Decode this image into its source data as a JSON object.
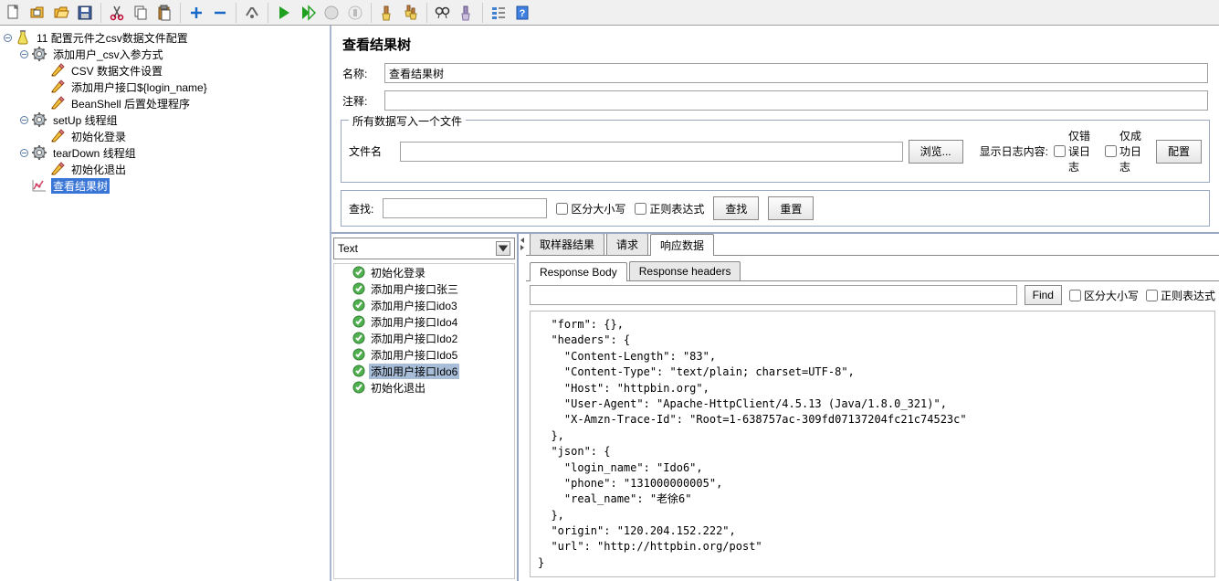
{
  "toolbar_icons": [
    "file",
    "folder-doc",
    "folder-open",
    "save",
    "blank",
    "cut",
    "copy",
    "paste",
    "blank",
    "plus",
    "minus",
    "blank",
    "wrench",
    "blank",
    "play",
    "play-all",
    "stop",
    "stop2",
    "blank",
    "broom",
    "broom2",
    "blank",
    "binocular",
    "broom3",
    "blank",
    "checklist",
    "help"
  ],
  "tree": {
    "root": {
      "label": "11 配置元件之csv数据文件配置",
      "icon": "beaker"
    },
    "children": [
      {
        "label": "添加用户_csv入参方式",
        "icon": "gear",
        "children": [
          {
            "label": "CSV 数据文件设置",
            "icon": "pencil"
          },
          {
            "label": "添加用户接口${login_name}",
            "icon": "pencil"
          },
          {
            "label": "BeanShell 后置处理程序",
            "icon": "pencil"
          }
        ]
      },
      {
        "label": "setUp 线程组",
        "icon": "gear",
        "children": [
          {
            "label": "初始化登录",
            "icon": "pencil"
          }
        ]
      },
      {
        "label": "tearDown 线程组",
        "icon": "gear",
        "children": [
          {
            "label": "初始化退出",
            "icon": "pencil"
          }
        ]
      },
      {
        "label": "查看结果树",
        "icon": "chart",
        "selected": true
      }
    ]
  },
  "panel": {
    "title": "查看结果树",
    "name_label": "名称:",
    "name_value": "查看结果树",
    "comment_label": "注释:",
    "comment_value": "",
    "file_legend": "所有数据写入一个文件",
    "file_label": "文件名",
    "file_value": "",
    "browse": "浏览...",
    "log_content": "显示日志内容:",
    "only_error": "仅错误日志",
    "only_success": "仅成功日志",
    "config": "配置"
  },
  "search": {
    "label": "查找:",
    "case": "区分大小写",
    "regex": "正则表达式",
    "find_btn": "查找",
    "reset_btn": "重置"
  },
  "combo": {
    "value": "Text"
  },
  "results": [
    {
      "label": "初始化登录"
    },
    {
      "label": "添加用户接口张三"
    },
    {
      "label": "添加用户接口ido3"
    },
    {
      "label": "添加用户接口Ido4"
    },
    {
      "label": "添加用户接口Ido2"
    },
    {
      "label": "添加用户接口Ido5"
    },
    {
      "label": "添加用户接口Ido6",
      "selected": true
    },
    {
      "label": "初始化退出"
    }
  ],
  "tabs": {
    "sampler": "取样器结果",
    "request": "请求",
    "response": "响应数据"
  },
  "subtabs": {
    "body": "Response Body",
    "headers": "Response headers"
  },
  "find": {
    "btn": "Find",
    "case": "区分大小写",
    "regex": "正则表达式"
  },
  "response_text": "  \"form\": {},\n  \"headers\": {\n    \"Content-Length\": \"83\",\n    \"Content-Type\": \"text/plain; charset=UTF-8\",\n    \"Host\": \"httpbin.org\",\n    \"User-Agent\": \"Apache-HttpClient/4.5.13 (Java/1.8.0_321)\",\n    \"X-Amzn-Trace-Id\": \"Root=1-638757ac-309fd07137204fc21c74523c\"\n  },\n  \"json\": {\n    \"login_name\": \"Ido6\",\n    \"phone\": \"131000000005\",\n    \"real_name\": \"老徐6\"\n  },\n  \"origin\": \"120.204.152.222\",\n  \"url\": \"http://httpbin.org/post\"\n}"
}
